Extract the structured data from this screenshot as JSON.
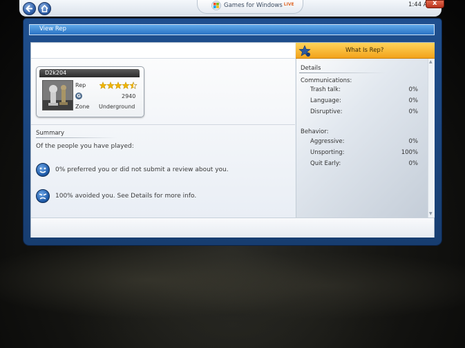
{
  "topbar": {
    "brand_text": "Games for Windows",
    "brand_live": "LIVE",
    "clock": "1:44 AM",
    "close_label": "x"
  },
  "window": {
    "title": "View Rep"
  },
  "card": {
    "gamertag": "D2k204",
    "rep_label": "Rep",
    "rep_stars": 4.5,
    "gamerscore_icon": "G",
    "gamerscore": "2940",
    "zone_label": "Zone",
    "zone_value": "Underground"
  },
  "summary": {
    "title": "Summary",
    "intro": "Of the people you have played:",
    "preferred": "0% preferred you or did not submit a review about you.",
    "avoided": "100% avoided you. See Details for more info."
  },
  "details": {
    "header": "What Is Rep?",
    "title": "Details",
    "communications_label": "Communications:",
    "communications": [
      {
        "label": "Trash talk:",
        "value": "0%"
      },
      {
        "label": "Language:",
        "value": "0%"
      },
      {
        "label": "Disruptive:",
        "value": "0%"
      }
    ],
    "behavior_label": "Behavior:",
    "behavior": [
      {
        "label": "Aggressive:",
        "value": "0%"
      },
      {
        "label": "Unsporting:",
        "value": "100%"
      },
      {
        "label": "Quit Early:",
        "value": "0%"
      }
    ]
  },
  "colors": {
    "accent": "#2a73c4",
    "header_orange": "#f2a31b",
    "star_gold": "#f0b400"
  }
}
